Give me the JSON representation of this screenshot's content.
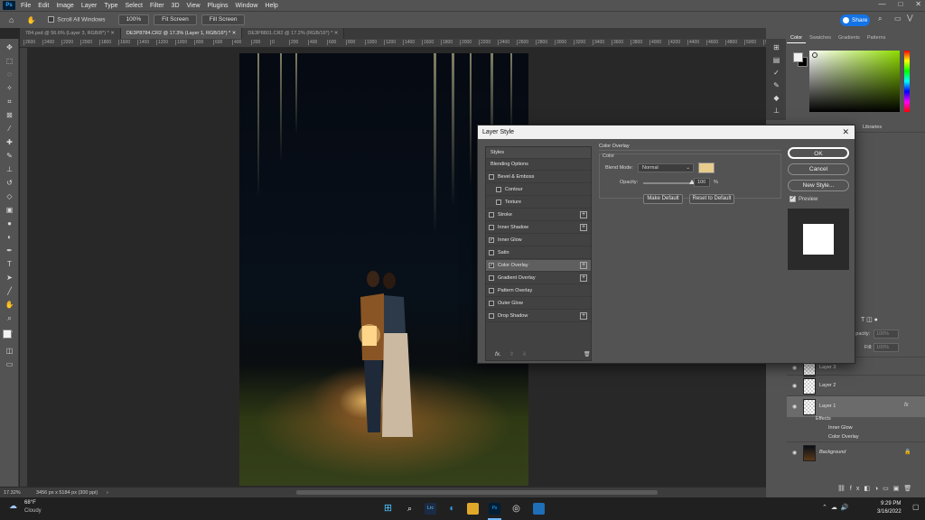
{
  "menu": {
    "items": [
      "File",
      "Edit",
      "Image",
      "Layer",
      "Type",
      "Select",
      "Filter",
      "3D",
      "View",
      "Plugins",
      "Window",
      "Help"
    ],
    "window_controls": [
      "—",
      "□",
      "✕"
    ]
  },
  "options": {
    "scroll_all_windows": "Scroll All Windows",
    "zoom_100": "100%",
    "fit_screen": "Fit Screen",
    "fill_screen": "Fill Screen",
    "share": "Share"
  },
  "tabs": [
    {
      "label": "784.psd @ 56.6% (Layer 3, RGB/8*) *",
      "active": false
    },
    {
      "label": "DE3P8784.CR2 @ 17.3% (Layer 1, RGB/16*) *",
      "active": true
    },
    {
      "label": "DE3P8801.CR2 @ 17.2% (RGB/16*) *",
      "active": false
    }
  ],
  "ruler_ticks": [
    "2600",
    "2400",
    "2200",
    "2000",
    "1800",
    "1600",
    "1400",
    "1200",
    "1000",
    "800",
    "600",
    "400",
    "200",
    "0",
    "200",
    "400",
    "600",
    "800",
    "1000",
    "1200",
    "1400",
    "1600",
    "1800",
    "2000",
    "2200",
    "2400",
    "2600",
    "2800",
    "3000",
    "3200",
    "3400",
    "3600",
    "3800",
    "4000",
    "4200",
    "4400",
    "4600",
    "4800",
    "5000",
    "5200"
  ],
  "status": {
    "zoom": "17.32%",
    "doc_info": "3456 px x 5184 px (300 ppi)"
  },
  "color_panel": {
    "tabs": [
      "Color",
      "Swatches",
      "Gradients",
      "Patterns"
    ],
    "foreground": "#f2f2f2",
    "background": "#000000"
  },
  "side_panel": {
    "libraries_tab": "Libraries"
  },
  "layers_panel": {
    "opacity_label": "Opacity:",
    "opacity_value": "100%",
    "fill_label": "Fill:",
    "fill_value": "100%",
    "layers": [
      {
        "name": "Layer 3",
        "fx": false
      },
      {
        "name": "Layer 2",
        "fx": false
      },
      {
        "name": "Layer 1",
        "fx": true,
        "selected": true
      },
      {
        "name": "Background",
        "fx": false
      }
    ],
    "effects_label": "Effects",
    "effects": [
      "Inner Glow",
      "Color Overlay"
    ]
  },
  "dialog": {
    "title": "Layer Style",
    "styles_header": "Styles",
    "blending_options": "Blending Options",
    "items": [
      {
        "label": "Bevel & Emboss",
        "checked": false,
        "plus": false,
        "indent": false
      },
      {
        "label": "Contour",
        "checked": false,
        "plus": false,
        "indent": true
      },
      {
        "label": "Texture",
        "checked": false,
        "plus": false,
        "indent": true
      },
      {
        "label": "Stroke",
        "checked": false,
        "plus": true,
        "indent": false
      },
      {
        "label": "Inner Shadow",
        "checked": false,
        "plus": true,
        "indent": false
      },
      {
        "label": "Inner Glow",
        "checked": true,
        "plus": false,
        "indent": false
      },
      {
        "label": "Satin",
        "checked": false,
        "plus": false,
        "indent": false
      },
      {
        "label": "Color Overlay",
        "checked": true,
        "plus": true,
        "indent": false,
        "selected": true
      },
      {
        "label": "Gradient Overlay",
        "checked": false,
        "plus": true,
        "indent": false
      },
      {
        "label": "Pattern Overlay",
        "checked": false,
        "plus": false,
        "indent": false
      },
      {
        "label": "Outer Glow",
        "checked": false,
        "plus": false,
        "indent": false
      },
      {
        "label": "Drop Shadow",
        "checked": false,
        "plus": true,
        "indent": false
      }
    ],
    "footer_fx": "fx.",
    "section_title": "Color Overlay",
    "group_title": "Color",
    "blend_mode_label": "Blend Mode:",
    "blend_mode_value": "Normal",
    "overlay_color": "#e8cc8e",
    "opacity_label": "Opacity:",
    "opacity_value": "100",
    "opacity_unit": "%",
    "opacity_level": 1.0,
    "make_default": "Make Default",
    "reset_default": "Reset to Default",
    "ok": "OK",
    "cancel": "Cancel",
    "new_style": "New Style...",
    "preview_label": "Preview",
    "preview_checked": true
  },
  "taskbar": {
    "temperature": "68°F",
    "weather": "Cloudy",
    "time": "9:29 PM",
    "date": "3/16/2022"
  }
}
